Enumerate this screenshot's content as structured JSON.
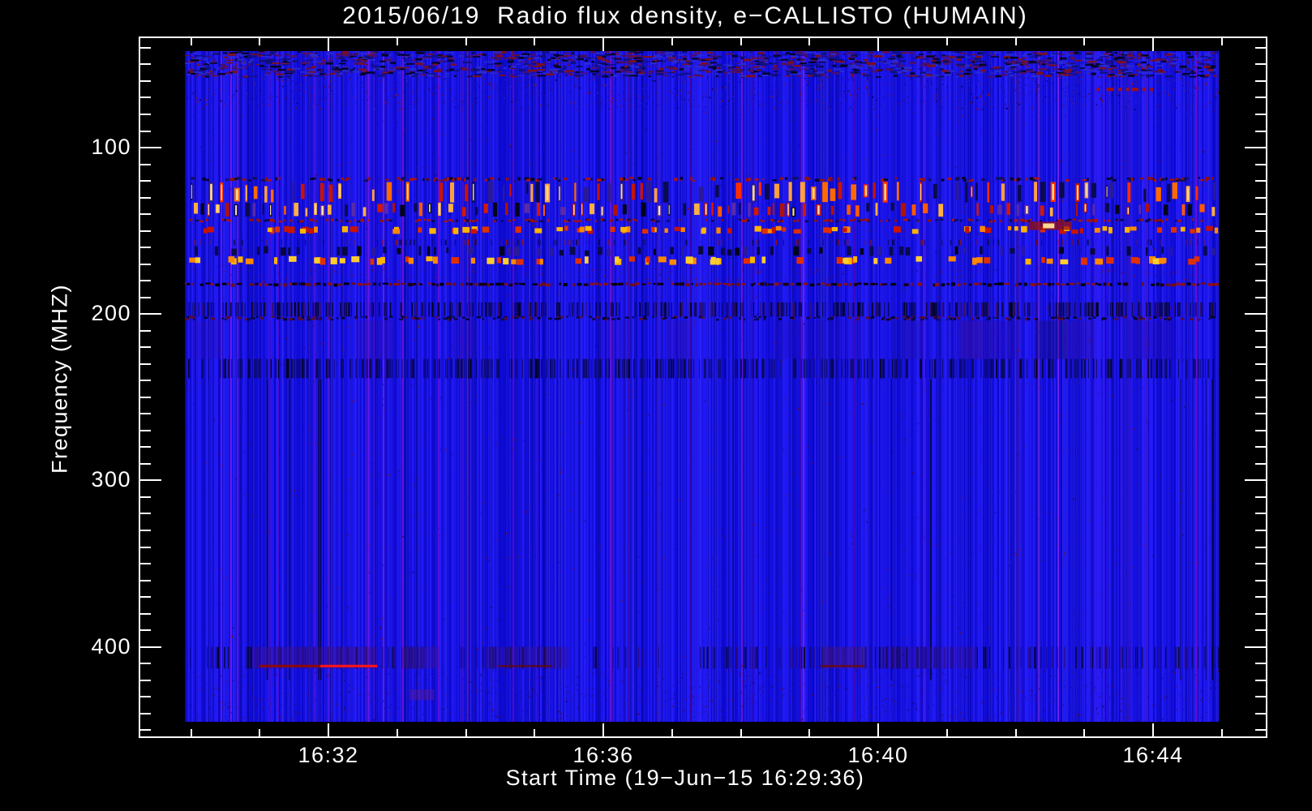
{
  "chart_data": {
    "type": "heatmap",
    "subtype": "radio-spectrogram",
    "title": "2015/06/19  Radio flux density, e−CALLISTO (HUMAIN)",
    "xlabel": "Start Time (19−Jun−15 16:29:36)",
    "ylabel": "Frequency (MHZ)",
    "x_axis": {
      "tick_labels": [
        "16:32",
        "16:36",
        "16:40",
        "16:44"
      ],
      "minor_tick_interval_minutes": 1,
      "start_time": "16:29:36",
      "date": "19-Jun-15"
    },
    "y_axis": {
      "tick_values": [
        100,
        200,
        300,
        400
      ],
      "tick_labels": [
        "100",
        "200",
        "300",
        "400"
      ],
      "minor_tick_step_mhz": 10,
      "range_mhz": [
        42,
        445
      ],
      "unit": "MHZ",
      "direction": "increasing-downward"
    },
    "colors": {
      "page_background": "#000000",
      "frame_and_text": "#ffffff",
      "base_blue": "#1512e0",
      "burst_red": "#e02400",
      "burst_orange": "#ff7a00",
      "burst_yellow": "#ffb400",
      "rfi_dark_navy": "#05051e",
      "interference_purple": "#46148c",
      "bright_line_red": "#ff1414"
    },
    "bands": [
      {
        "name": "global-specks",
        "f_lo": 42,
        "f_hi": 445,
        "style": "speckle",
        "density": 0.045,
        "colors": [
          "#7a1014",
          "#3a0a50",
          "#101080"
        ]
      },
      {
        "name": "top-noise-speckle",
        "f_lo": 42,
        "f_hi": 77,
        "style": "speckle",
        "density": 0.6,
        "colors": [
          "#6e0f14",
          "#8f1010",
          "#000060",
          "#0a0ac0",
          "#3a0a50",
          "#2a2ad0"
        ]
      },
      {
        "name": "top-streak-rows",
        "f_lo": 42,
        "f_hi": 58,
        "style": "dashes",
        "density": 0.5,
        "colors": [
          "#4a0f6a",
          "#7a1020",
          "#101080",
          "#2a2ad0",
          "#05052a"
        ],
        "dash_w": [
          3,
          11
        ],
        "dash_h": [
          1,
          3
        ]
      },
      {
        "name": "rfi-fleck-row-119",
        "f_lo": 117.5,
        "f_hi": 120.5,
        "style": "dashes",
        "density": 0.3,
        "colors": [
          "#8f1010",
          "#101060",
          "#b01208",
          "#05052a"
        ],
        "dash_w": [
          2,
          6
        ],
        "dash_h": [
          2,
          4
        ]
      },
      {
        "name": "burst-band-127",
        "f_lo": 120.5,
        "f_hi": 133,
        "style": "bursts",
        "density": 0.5,
        "colors": [
          "#c81400",
          "#ff2e00",
          "#ff6a00",
          "#ffa040",
          "#2a1a9a",
          "#0a0a50"
        ],
        "bright": "#ffd890"
      },
      {
        "name": "burst-band-137",
        "f_lo": 133,
        "f_hi": 141.5,
        "style": "bursts",
        "density": 0.62,
        "colors": [
          "#d41800",
          "#ff5a00",
          "#ffb040",
          "#0a0a50",
          "#04041c",
          "#5a2aa8",
          "#b01208"
        ],
        "bright": "#ffe6a8"
      },
      {
        "name": "fleck-row-144",
        "f_lo": 142.6,
        "f_hi": 145,
        "style": "dashes",
        "density": 0.3,
        "colors": [
          "#b01208",
          "#8f1010",
          "#0a0a50"
        ],
        "dash_w": [
          2,
          5
        ],
        "dash_h": [
          2,
          3
        ]
      },
      {
        "name": "yellow-dash-row-150",
        "f_lo": 147,
        "f_hi": 152,
        "style": "dashes",
        "density": 0.28,
        "colors": [
          "#ffb400",
          "#e03000",
          "#ff8800",
          "#c81400"
        ],
        "dash_w": [
          4,
          9
        ],
        "dash_h": [
          5,
          8
        ]
      },
      {
        "name": "sparse-tick-row-157",
        "f_lo": 155.3,
        "f_hi": 158.7,
        "style": "vlines",
        "density": 0.14,
        "colors": [
          "#0a0a50",
          "#8f1010"
        ]
      },
      {
        "name": "navy-dash-band-162",
        "f_lo": 159.2,
        "f_hi": 165,
        "style": "bursts",
        "density": 0.45,
        "colors": [
          "#08083e",
          "#04041c",
          "#2a1a9a",
          "#0a0a50"
        ],
        "bright": null
      },
      {
        "name": "yellow-dash-row-167",
        "f_lo": 165.2,
        "f_hi": 170.5,
        "style": "dashes",
        "density": 0.3,
        "colors": [
          "#ffb400",
          "#ffcc30",
          "#e03000",
          "#ff8800"
        ],
        "dash_w": [
          4,
          10
        ],
        "dash_h": [
          6,
          9
        ]
      },
      {
        "name": "red-speckle-176",
        "f_lo": 172.5,
        "f_hi": 180.5,
        "style": "speckle",
        "density": 0.35,
        "colors": [
          "#8f1010",
          "#5a0a30",
          "#2a1a9a"
        ]
      },
      {
        "name": "dark-line-182",
        "f_lo": 181,
        "f_hi": 183,
        "style": "darkline",
        "density": 0.92,
        "colors": [
          "#000008",
          "#1a0008",
          "#6e0f14",
          "#8f1010"
        ]
      },
      {
        "name": "vline-band-197",
        "f_lo": 193,
        "f_hi": 201.5,
        "style": "vlines",
        "density": 0.55,
        "colors": [
          "#05052a",
          "#0a0a50",
          "#3a1060",
          "#01010e"
        ]
      },
      {
        "name": "fleck-row-202",
        "f_lo": 201,
        "f_hi": 204,
        "style": "dashes",
        "density": 0.3,
        "colors": [
          "#05052a",
          "#5a0a30",
          "#0a0a50"
        ],
        "dash_w": [
          2,
          5
        ],
        "dash_h": [
          2,
          3
        ]
      },
      {
        "name": "purple-smudge-zone-215",
        "f_lo": 204,
        "f_hi": 227,
        "style": "smudges",
        "density": 0.55,
        "colors": [
          "#3a10a0",
          "#28089a",
          "#1a1060"
        ]
      },
      {
        "name": "textured-band-233",
        "f_lo": 227,
        "f_hi": 238.5,
        "style": "vlines",
        "density": 0.5,
        "colors": [
          "#0b0b6e",
          "#0a0a50",
          "#05051e"
        ]
      },
      {
        "name": "black-line-cols-233",
        "f_lo": 227,
        "f_hi": 238.5,
        "style": "vlines",
        "density": 0.02,
        "colors": [
          "#010114"
        ]
      },
      {
        "name": "sparse-dark-cols-low",
        "f_lo": 239,
        "f_hi": 420,
        "style": "vlines",
        "density": 0.012,
        "colors": [
          "#05051c"
        ]
      },
      {
        "name": "band-405-texture",
        "f_lo": 400,
        "f_hi": 413,
        "style": "vlines",
        "density": 0.3,
        "colors": [
          "#0c0c70",
          "#2a0a70",
          "#05052a"
        ]
      },
      {
        "name": "bottom-speckle",
        "f_lo": 413.5,
        "f_hi": 444,
        "style": "speckle",
        "density": 0.3,
        "colors": [
          "#2a0a60",
          "#0a0a80",
          "#5a0a30",
          "#3a0a50"
        ]
      }
    ],
    "features": [
      {
        "name": "purple-patch-a",
        "type": "patch",
        "f_lo": 400,
        "f_hi": 413,
        "x0": 0.065,
        "x1": 0.186,
        "color": "#46148c",
        "alpha": 0.42
      },
      {
        "name": "purple-patch-b",
        "type": "patch",
        "f_lo": 400,
        "f_hi": 413,
        "x0": 0.212,
        "x1": 0.246,
        "color": "#46148c",
        "alpha": 0.38
      },
      {
        "name": "purple-patch-c",
        "type": "patch",
        "f_lo": 400,
        "f_hi": 413,
        "x0": 0.29,
        "x1": 0.371,
        "color": "#46148c",
        "alpha": 0.33
      },
      {
        "name": "purple-patch-d",
        "type": "patch",
        "f_lo": 400,
        "f_hi": 413,
        "x0": 0.616,
        "x1": 0.659,
        "color": "#50188c",
        "alpha": 0.42
      },
      {
        "name": "purple-patch-e",
        "type": "patch",
        "f_lo": 400,
        "f_hi": 413,
        "x0": 0.676,
        "x1": 0.766,
        "color": "#46148c",
        "alpha": 0.27
      },
      {
        "name": "purple-speckle-patch",
        "type": "patch",
        "f_lo": 425.5,
        "f_hi": 432,
        "x0": 0.217,
        "x1": 0.241,
        "color": "#5a1a9a",
        "alpha": 0.5
      },
      {
        "name": "red-blob-147",
        "type": "patch",
        "f_lo": 144.5,
        "f_hi": 149.5,
        "x0": 0.816,
        "x1": 0.858,
        "color": "#a01008",
        "alpha": 0.75
      },
      {
        "name": "red-blob-core",
        "type": "hline",
        "f": 147,
        "x0": 0.83,
        "x1": 0.841,
        "color": "#ffd890",
        "h": 6
      },
      {
        "name": "red-line-405-dark",
        "type": "hline",
        "f": 411.5,
        "x0": 0.072,
        "x1": 0.131,
        "color": "#8c0a0c",
        "h": 3
      },
      {
        "name": "red-line-405-bright",
        "type": "hline",
        "f": 411.5,
        "x0": 0.131,
        "x1": 0.186,
        "color": "#ff1414",
        "h": 3
      },
      {
        "name": "red-line-405-mid",
        "type": "hline",
        "f": 411.5,
        "x0": 0.303,
        "x1": 0.355,
        "color": "#5c0a14",
        "h": 2
      },
      {
        "name": "red-line-405-right",
        "type": "hline",
        "f": 411.5,
        "x0": 0.615,
        "x1": 0.657,
        "color": "#6e0a0a",
        "h": 2
      },
      {
        "name": "red-dash-row-65",
        "type": "dashrow",
        "f": 65,
        "x0": 0.882,
        "x1": 0.935,
        "color": "#a01010",
        "h": 4
      }
    ]
  }
}
